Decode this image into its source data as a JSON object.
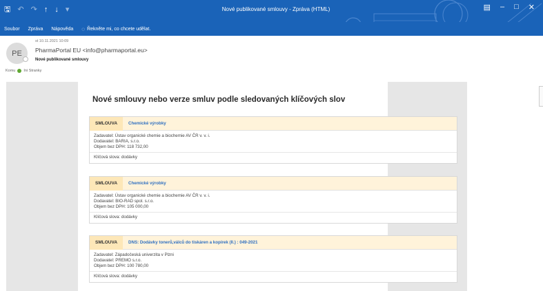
{
  "window": {
    "title": "Nové publikované smlouvy  -  Zpráva (HTML)"
  },
  "quick_access_icons": [
    "save-icon",
    "undo-icon",
    "redo-icon",
    "up-arrow-icon",
    "down-arrow-icon",
    "customize-icon"
  ],
  "ribbon": {
    "file": "Soubor",
    "message": "Zpráva",
    "help": "Nápověda",
    "tell_me": "Řekněte mi, co chcete udělat."
  },
  "header": {
    "avatar_initials": "PE",
    "date": "st 10.11.2021 10:09",
    "sender": "PharmaPortal EU <info@pharmaportal.eu>",
    "subject": "Nové publikované smlouvy",
    "to_label": "Komu",
    "to_value": "Ini Stranky"
  },
  "email": {
    "heading": "Nové smlouvy nebo verze smluv podle sledovaných klíčových slov",
    "cards": [
      {
        "badge": "SMLOUVA",
        "title": "Chemické výrobky",
        "zadavatel": "Zadavatel:  Ústav organické chemie a biochemie AV ČR v. v. i.",
        "dodavatel": "Dodavatel: BARIA, s.r.o.",
        "objem": "Objem bez DPH: 118 732,00",
        "keywords": "Klíčová slova: dodávky"
      },
      {
        "badge": "SMLOUVA",
        "title": "Chemické výrobky",
        "zadavatel": "Zadavatel:  Ústav organické chemie a biochemie AV ČR v. v. i.",
        "dodavatel": "Dodavatel: BIO-RAD spol. s.r.o.",
        "objem": "Objem bez DPH: 105 000,00",
        "keywords": "Klíčová slova: dodávky"
      },
      {
        "badge": "SMLOUVA",
        "title": "DNS: Dodávky tonerů,válců do tiskáren a kopírek (II.) : 049-2021",
        "zadavatel": "Zadavatel:  Západočeská univerzita v Plzni",
        "dodavatel": "Dodavatel: PREMO s.r.o.",
        "objem": "Objem bez DPH: 100 780,00",
        "keywords": "Klíčová slova: dodávky"
      }
    ]
  },
  "colors": {
    "titlebar": "#1a63b8",
    "badge_bg": "#fde7b8",
    "card_head_bg": "#fff3da",
    "link": "#2e6fc0",
    "presence": "#5fa832"
  }
}
